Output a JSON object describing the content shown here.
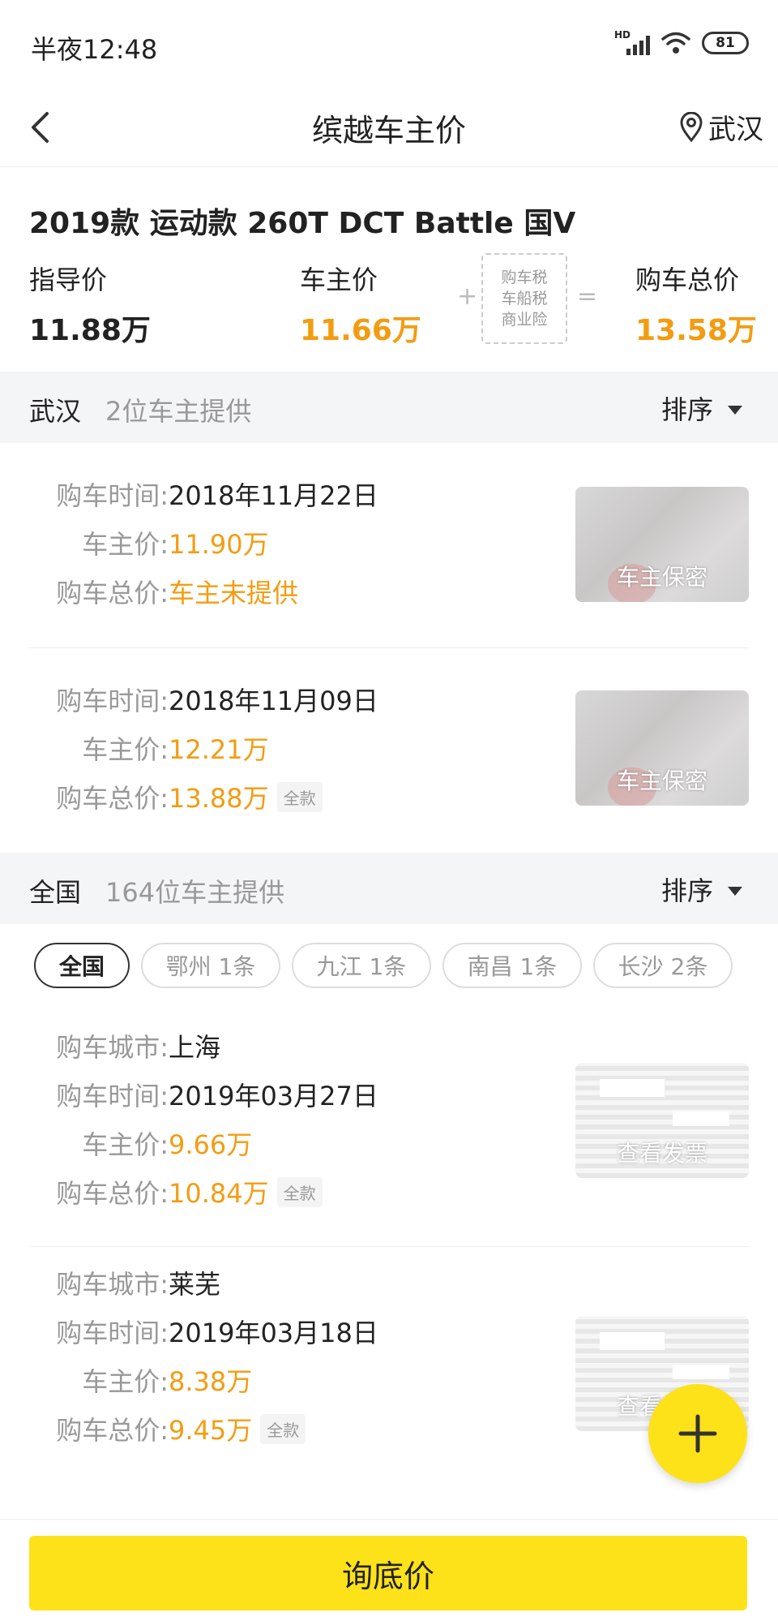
{
  "status_bar": {
    "time": "半夜12:48",
    "network": "HD",
    "battery": "81"
  },
  "nav": {
    "title": "缤越车主价",
    "location": "武汉"
  },
  "car": {
    "model": "2019款 运动款 260T DCT Battle 国V",
    "guide_label": "指导价",
    "guide_value": "11.88万",
    "owner_label": "车主价",
    "owner_value": "11.66万",
    "plus": "+",
    "taxes": [
      "购车税",
      "车船税",
      "商业险"
    ],
    "equals": "=",
    "total_label": "购车总价",
    "total_value": "13.58万"
  },
  "local_section": {
    "city": "武汉",
    "count": "2位车主提供",
    "sort": "排序",
    "records": [
      {
        "time_label": "购车时间:",
        "time": "2018年11月22日",
        "price_label": "车主价:",
        "price": "11.90万",
        "total_label": "购车总价:",
        "total": "车主未提供",
        "thumb_caption": "车主保密"
      },
      {
        "time_label": "购车时间:",
        "time": "2018年11月09日",
        "price_label": "车主价:",
        "price": "12.21万",
        "total_label": "购车总价:",
        "total": "13.88万",
        "tag": "全款",
        "thumb_caption": "车主保密"
      }
    ]
  },
  "national_section": {
    "city": "全国",
    "count": "164位车主提供",
    "sort": "排序",
    "chips": [
      {
        "label": "全国",
        "active": true
      },
      {
        "label": "鄂州 1条",
        "active": false
      },
      {
        "label": "九江 1条",
        "active": false
      },
      {
        "label": "南昌 1条",
        "active": false
      },
      {
        "label": "长沙 2条",
        "active": false
      }
    ],
    "records": [
      {
        "city_label": "购车城市:",
        "city": "上海",
        "time_label": "购车时间:",
        "time": "2019年03月27日",
        "price_label": "车主价:",
        "price": "9.66万",
        "total_label": "购车总价:",
        "total": "10.84万",
        "tag": "全款",
        "thumb_caption": "查看发票"
      },
      {
        "city_label": "购车城市:",
        "city": "莱芜",
        "time_label": "购车时间:",
        "time": "2019年03月18日",
        "price_label": "车主价:",
        "price": "8.38万",
        "total_label": "购车总价:",
        "total": "9.45万",
        "tag": "全款",
        "thumb_caption": "查看发票"
      }
    ]
  },
  "cta": {
    "label": "询底价"
  },
  "colors": {
    "accent_yellow": "#fde21a",
    "price_orange": "#f39c12",
    "muted_gray": "#999999",
    "section_bg": "#f4f5f7"
  }
}
